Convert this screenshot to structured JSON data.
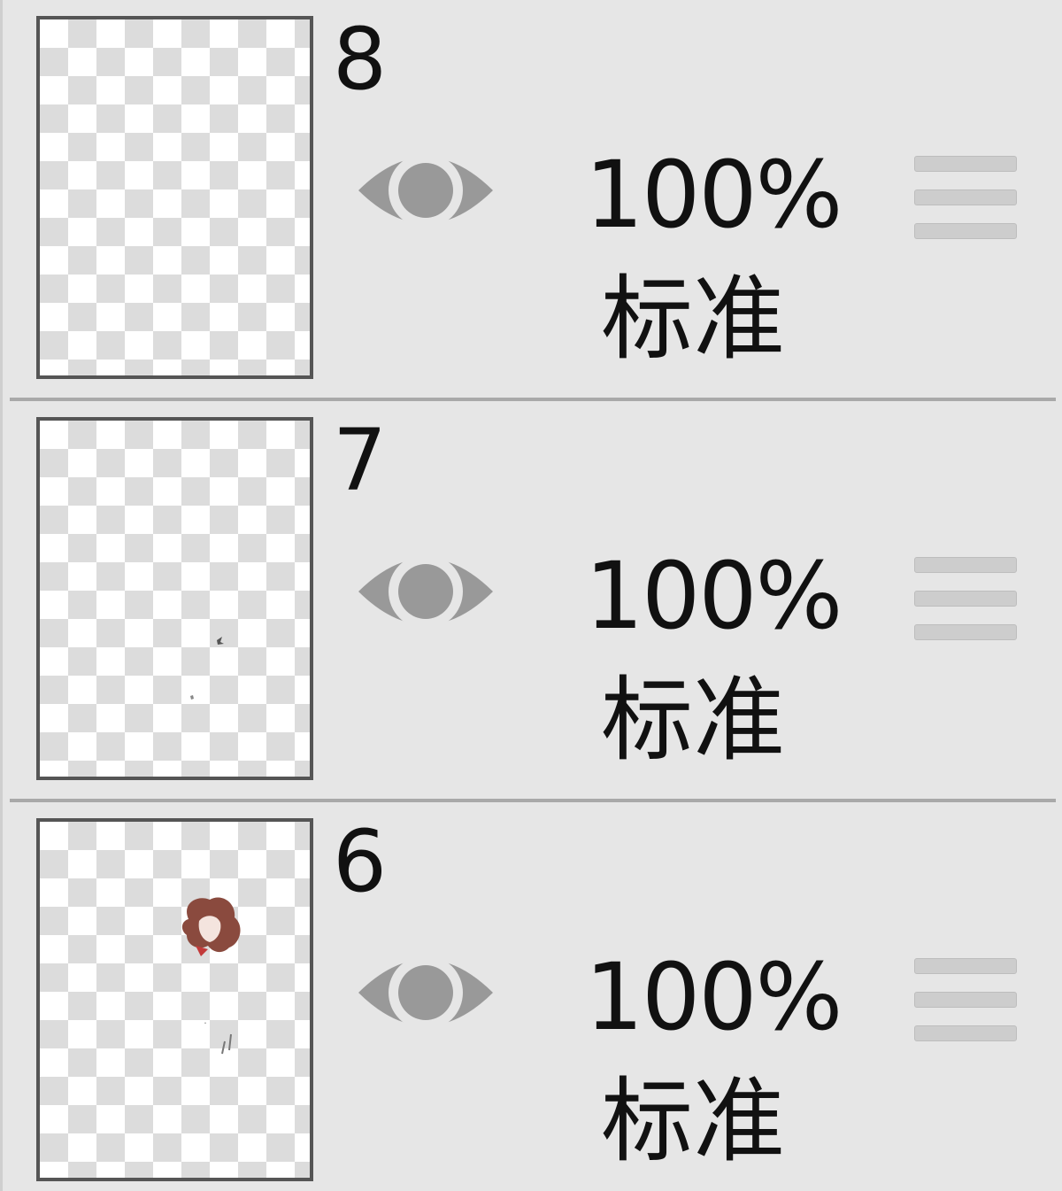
{
  "layers": [
    {
      "number": "8",
      "opacity": "100%",
      "blend_mode": "标准",
      "visible": true
    },
    {
      "number": "7",
      "opacity": "100%",
      "blend_mode": "标准",
      "visible": true
    },
    {
      "number": "6",
      "opacity": "100%",
      "blend_mode": "标准",
      "visible": true
    }
  ],
  "icons": {
    "visibility": "eye-icon",
    "reorder": "drag-handle-icon"
  },
  "colors": {
    "panel_bg": "#e6e6e6",
    "divider": "#a9a9a9",
    "icon_gray": "#999999",
    "text": "#111111"
  }
}
